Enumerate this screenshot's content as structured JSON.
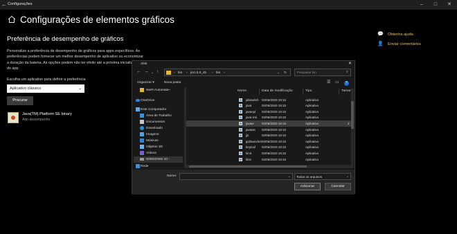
{
  "window": {
    "title": "Configurações",
    "controls": {
      "minimize": "–",
      "maximize": "□",
      "close": "✕"
    }
  },
  "page": {
    "title": "Configurações de elementos gráficos",
    "section_title": "Preferência de desempenho de gráficos",
    "description": "Personalize a preferência de desempenho de gráficos para apps específicos. As preferências podem fornecer um melhor desempenho de aplicativo ou economizar a duração da bateria. As opções podem não ter efeito até a próxima inicialização do app.",
    "choose_label": "Escolha um aplicativo para definir a preferência",
    "app_type_select": "Aplicativo clássico",
    "browse_button": "Procurar",
    "app_entry": {
      "name": "Java(TM) Platform SE binary",
      "subtitle": "Alto desempenho"
    }
  },
  "help": {
    "get_help": "Obtenha ajuda",
    "send_feedback": "Enviar comentários"
  },
  "dialog": {
    "title": "Abrir",
    "breadcrumbs": [
      "bin",
      "jre1.8.0_45",
      "bin"
    ],
    "search_placeholder": "Pesquisar bin",
    "organize": "Organizar ▾",
    "new_folder": "Nova pasta",
    "nav_items": [
      {
        "label": "NieR:Automata~",
        "icon": "folder-icon"
      },
      {
        "label": "OneDrive",
        "icon": "onedrive-icon"
      },
      {
        "label": "Este Computador",
        "icon": "computer-icon"
      },
      {
        "label": "Área de Trabalho",
        "icon": "desktop-icon"
      },
      {
        "label": "Documentos",
        "icon": "documents-icon"
      },
      {
        "label": "Downloads",
        "icon": "downloads-icon"
      },
      {
        "label": "Imagens",
        "icon": "pictures-icon"
      },
      {
        "label": "Músicas",
        "icon": "music-icon"
      },
      {
        "label": "Objetos 3D",
        "icon": "objects3d-icon"
      },
      {
        "label": "Vídeos",
        "icon": "videos-icon"
      },
      {
        "label": "WINDOWS 10 - ",
        "icon": "drive-icon"
      },
      {
        "label": "Rede",
        "icon": "network-icon"
      }
    ],
    "columns": {
      "name": "Nome",
      "date": "Data de modificação",
      "type": "Tipo",
      "size": "Taman"
    },
    "files": [
      {
        "name": "jabswitch",
        "date": "02/06/2020 19:15",
        "type": "Aplicativo",
        "size": ""
      },
      {
        "name": "java",
        "date": "02/06/2020 19:15",
        "type": "Aplicativo",
        "size": ""
      },
      {
        "name": "javacpl",
        "date": "02/06/2020 19:15",
        "type": "Aplicativo",
        "size": ""
      },
      {
        "name": "java-rmi",
        "date": "02/06/2020 19:15",
        "type": "Aplicativo",
        "size": ""
      },
      {
        "name": "javaw",
        "date": "02/06/2020 19:15",
        "type": "Aplicativo",
        "size": "2"
      },
      {
        "name": "javaws",
        "date": "02/06/2020 19:15",
        "type": "Aplicativo",
        "size": ""
      },
      {
        "name": "jjs",
        "date": "02/06/2020 19:15",
        "type": "Aplicativo",
        "size": ""
      },
      {
        "name": "jp2launcher",
        "date": "02/06/2020 19:15",
        "type": "Aplicativo",
        "size": ""
      },
      {
        "name": "keytool",
        "date": "02/06/2020 19:15",
        "type": "Aplicativo",
        "size": ""
      },
      {
        "name": "kinit",
        "date": "02/06/2020 19:15",
        "type": "Aplicativo",
        "size": ""
      },
      {
        "name": "klist",
        "date": "02/06/2020 19:15",
        "type": "Aplicativo",
        "size": ""
      }
    ],
    "name_label": "Nome:",
    "name_value": "",
    "filetype": "Todos os arquivos",
    "open_button": "Adicionar",
    "cancel_button": "Cancelar"
  }
}
